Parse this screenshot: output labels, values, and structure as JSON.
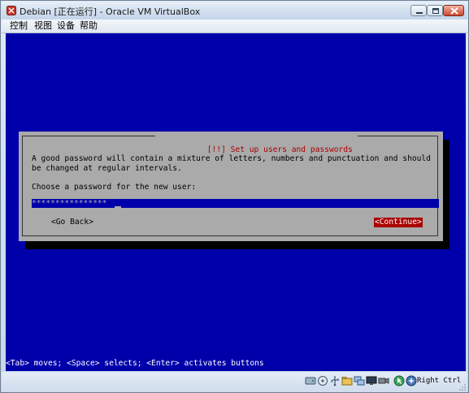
{
  "window": {
    "title": "Debian [正在运行] - Oracle VM VirtualBox"
  },
  "menu": [
    "控制",
    "视图",
    "设备",
    "帮助"
  ],
  "installer": {
    "dialog_title": "[!!] Set up users and passwords",
    "description": "A good password will contain a mixture of letters, numbers and punctuation and should be changed at regular intervals.",
    "prompt": "Choose a password for the new user:",
    "password_mask": "****************",
    "go_back_label": "<Go Back>",
    "continue_label": "<Continue>",
    "help_line": "<Tab> moves; <Space> selects; <Enter> activates buttons"
  },
  "status_bar": {
    "icons": [
      "hard-disk-icon",
      "optical-drive-icon",
      "usb-icon",
      "shared-folders-icon",
      "network-icon",
      "display-icon",
      "video-capture-icon",
      "mouse-integration-icon",
      "keyboard-capture-icon"
    ],
    "host_key": "Right Ctrl"
  },
  "colors": {
    "screen_bg": "#0000AA",
    "dialog_bg": "#AAAAAA",
    "title_red": "#AA0000",
    "button_selected_bg": "#AA0000"
  }
}
